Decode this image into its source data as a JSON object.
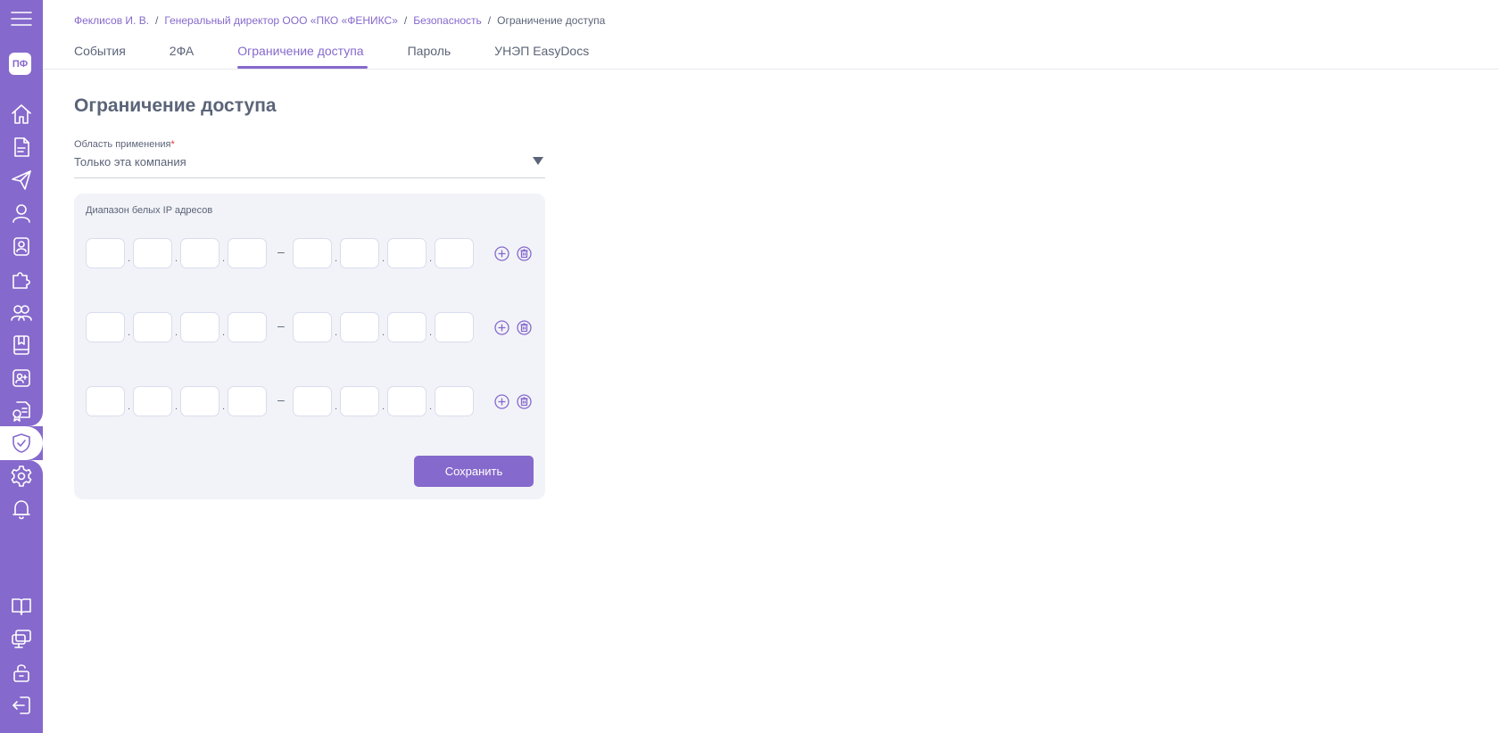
{
  "sidebar": {
    "avatar_initials": "ПФ",
    "accent_color": "#8669cc",
    "items": [
      {
        "icon": "menu-icon"
      },
      {
        "icon": "home-icon"
      },
      {
        "icon": "document-icon"
      },
      {
        "icon": "paper-plane-icon"
      },
      {
        "icon": "user-icon"
      },
      {
        "icon": "user-badge-icon"
      },
      {
        "icon": "puzzle-icon"
      },
      {
        "icon": "users-group-icon"
      },
      {
        "icon": "book-icon"
      },
      {
        "icon": "add-user-icon"
      },
      {
        "icon": "certificate-icon"
      },
      {
        "icon": "shield-check-icon",
        "active": true
      },
      {
        "icon": "gear-icon"
      },
      {
        "icon": "bell-icon"
      },
      {
        "icon": "open-book-icon"
      },
      {
        "icon": "monitor-icon"
      },
      {
        "icon": "unlock-icon"
      },
      {
        "icon": "logout-icon"
      }
    ]
  },
  "breadcrumb": {
    "items": [
      "Феклисов И. В.",
      "Генеральный директор ООО «ПКО «ФЕНИКС»",
      "Безопасность"
    ],
    "separator": "/",
    "current": "Ограничение доступа"
  },
  "tabs": [
    {
      "label": "События"
    },
    {
      "label": "2ФА"
    },
    {
      "label": "Ограничение доступа",
      "active": true
    },
    {
      "label": "Пароль"
    },
    {
      "label": "УНЭП EasyDocs"
    }
  ],
  "page": {
    "title": "Ограничение доступа"
  },
  "scope": {
    "label": "Область применения",
    "required_mark": "*",
    "value": "Только эта компания"
  },
  "ip_panel": {
    "title": "Диапазон белых IP адресов",
    "separator_dot": ".",
    "range_dash": "–",
    "rows": [
      {
        "from": [
          "",
          "",
          "",
          ""
        ],
        "to": [
          "",
          "",
          "",
          ""
        ]
      },
      {
        "from": [
          "",
          "",
          "",
          ""
        ],
        "to": [
          "",
          "",
          "",
          ""
        ]
      },
      {
        "from": [
          "",
          "",
          "",
          ""
        ],
        "to": [
          "",
          "",
          "",
          ""
        ]
      }
    ]
  },
  "actions": {
    "save_label": "Сохранить"
  }
}
